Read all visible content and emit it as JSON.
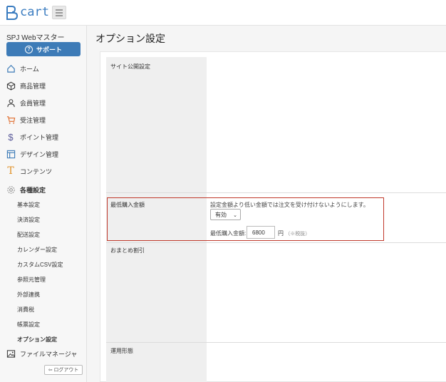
{
  "header": {
    "logo_text": "cart"
  },
  "sidebar": {
    "site_name": "SPJ Webマスター",
    "support_label": "サポート",
    "items": [
      {
        "label": "ホーム",
        "icon": "home-icon"
      },
      {
        "label": "商品管理",
        "icon": "box-icon"
      },
      {
        "label": "会員管理",
        "icon": "user-icon"
      },
      {
        "label": "受注管理",
        "icon": "cart-icon"
      },
      {
        "label": "ポイント管理",
        "icon": "dollar-icon"
      },
      {
        "label": "デザイン管理",
        "icon": "layout-icon"
      },
      {
        "label": "コンテンツ",
        "icon": "text-icon"
      },
      {
        "label": "各種設定",
        "icon": "gear-icon"
      }
    ],
    "sub_items": [
      "基本設定",
      "決済設定",
      "配送設定",
      "カレンダー設定",
      "カスタムCSV設定",
      "参照元管理",
      "外部連携",
      "消費税",
      "帳票設定",
      "オプション設定"
    ],
    "file_manager_label": "ファイルマネージャ",
    "logout_label": "ログアウト"
  },
  "main": {
    "title": "オプション設定",
    "rows": [
      {
        "label": "サイト公開設定"
      },
      {
        "label": "最低購入金額"
      },
      {
        "label": "おまとめ割引"
      },
      {
        "label": "運用形態"
      }
    ],
    "min_purchase": {
      "description": "設定金額より低い金額では注文を受け付けないようにします。",
      "status_value": "有効",
      "amount_label": "最低購入金額:",
      "amount_value": "6800",
      "unit": "円",
      "tax_note": "（※税抜）"
    }
  },
  "colors": {
    "accent": "#3d7bb7",
    "highlight": "#c0392b"
  }
}
